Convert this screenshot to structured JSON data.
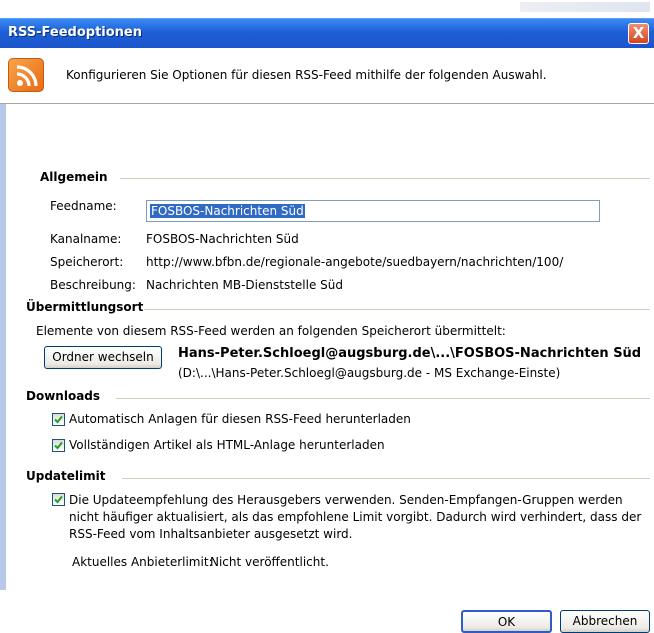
{
  "window": {
    "title": "RSS-Feedoptionen",
    "close_label": "X"
  },
  "header": {
    "icon": "rss-feed-icon",
    "description": "Konfigurieren Sie Optionen für diesen RSS-Feed mithilfe der folgenden Auswahl."
  },
  "general": {
    "heading": "Allgemein",
    "feedname_label": "Feedname:",
    "feedname_value": "FOSBOS-Nachrichten Süd",
    "channel_label": "Kanalname:",
    "channel_value": "FOSBOS-Nachrichten Süd",
    "location_label": "Speicherort:",
    "location_value": "http://www.bfbn.de/regionale-angebote/suedbayern/nachrichten/100/",
    "description_label": "Beschreibung:",
    "description_value": "Nachrichten MB-Dienststelle Süd"
  },
  "delivery": {
    "heading": "Übermittlungsort",
    "intro": "Elemente von diesem RSS-Feed werden an folgenden Speicherort übermittelt:",
    "change_folder_button": "Ordner wechseln",
    "folder_path": "Hans-Peter.Schloegl@augsburg.de\\...\\FOSBOS-Nachrichten Süd",
    "folder_detail": "(D:\\...\\Hans-Peter.Schloegl@augsburg.de - MS Exchange-Einste)"
  },
  "downloads": {
    "heading": "Downloads",
    "options": [
      {
        "label": "Automatisch Anlagen für diesen RSS-Feed herunterladen",
        "checked": true
      },
      {
        "label": "Vollständigen Artikel als HTML-Anlage herunterladen",
        "checked": true
      }
    ]
  },
  "update_limit": {
    "heading": "Updatelimit",
    "option_text": "Die Updateempfehlung des Herausgebers verwenden. Senden-Empfangen-Gruppen werden nicht häufiger aktualisiert, als das empfohlene Limit vorgibt. Dadurch wird verhindert, dass der RSS-Feed vom Inhaltsanbieter ausgesetzt wird.",
    "checked": true,
    "current_limit_label": "Aktuelles Anbieterlimit:",
    "current_limit_value": "Nicht veröffentlicht."
  },
  "buttons": {
    "ok": "OK",
    "cancel": "Abbrechen"
  },
  "colors": {
    "titlebar": "#1e5fd6",
    "dialog_bg": "#ece9d8",
    "selection": "#316ac5",
    "close": "#d5451e"
  }
}
